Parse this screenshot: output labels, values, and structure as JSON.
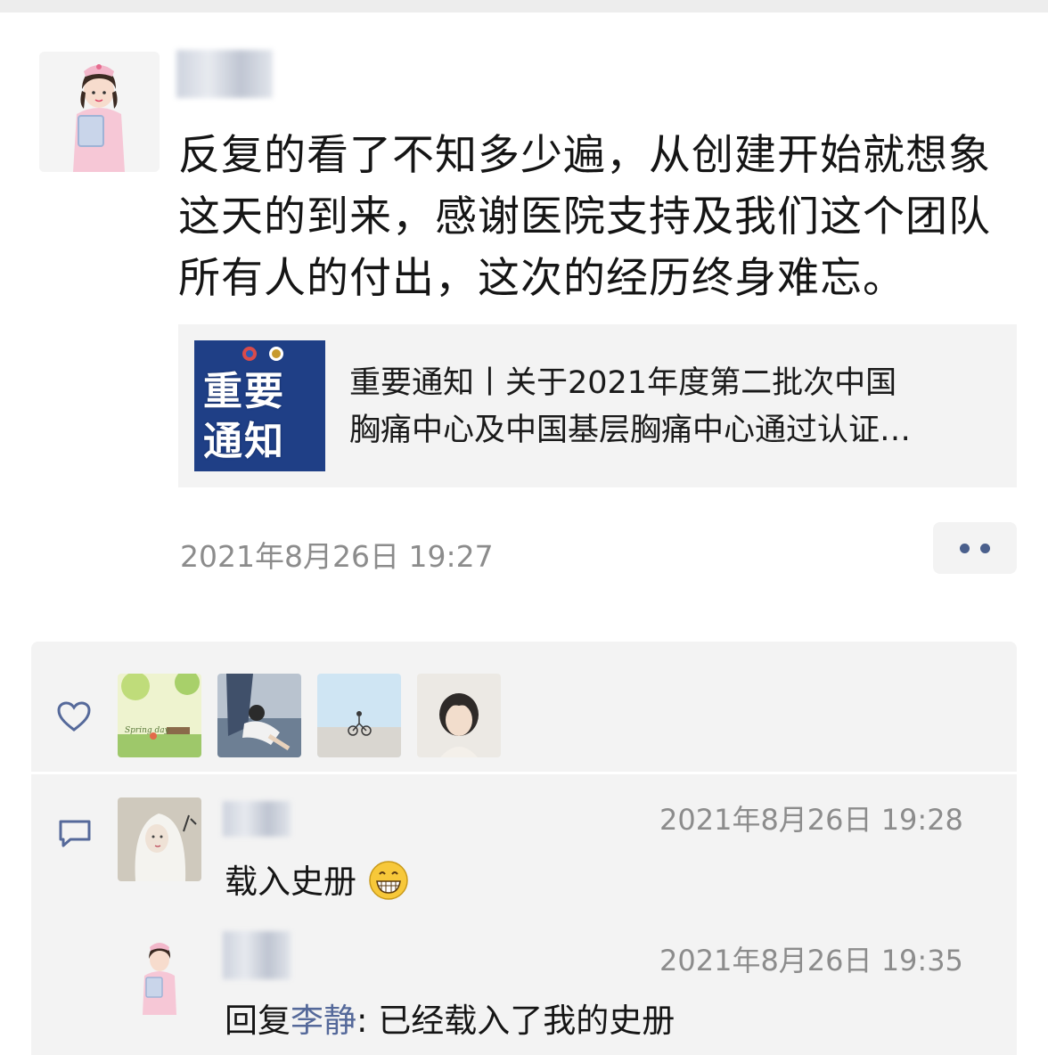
{
  "post": {
    "text_lines": [
      "反复的看了不知多少遍，从创建开始就想象",
      "这天的到来，感谢医院支持及我们这个团队",
      "所有人的付出，这次的经历终身难忘。"
    ],
    "link": {
      "thumb_text": [
        "重要",
        "通知"
      ],
      "title_lines": [
        "重要通知丨关于2021年度第二批次中国",
        "胸痛中心及中国基层胸痛中心通过认证…"
      ]
    },
    "time": "2021年8月26日 19:27"
  },
  "likes": {
    "icon": "heart-outline-icon",
    "avatars": [
      "spring-day-avatar",
      "girl-by-water-avatar",
      "beach-bicycle-avatar",
      "girl-portrait-avatar"
    ],
    "thumb_caption": "Spring day"
  },
  "comments": {
    "icon": "comment-bubble-icon",
    "items": [
      {
        "time": "2021年8月26日 19:28",
        "text": "载入史册",
        "emoji": "grinning-emoji",
        "avatar": "white-hair-girl-avatar"
      },
      {
        "time": "2021年8月26日 19:35",
        "reply_prefix": "回复",
        "reply_to": "李静",
        "text": ": 已经载入了我的史册",
        "avatar": "nurse-avatar"
      }
    ]
  },
  "colors": {
    "link_name": "#55699a",
    "meta": "#8c8c8c",
    "panel": "#f3f3f3",
    "thumb_bg": "#1f3f86"
  }
}
